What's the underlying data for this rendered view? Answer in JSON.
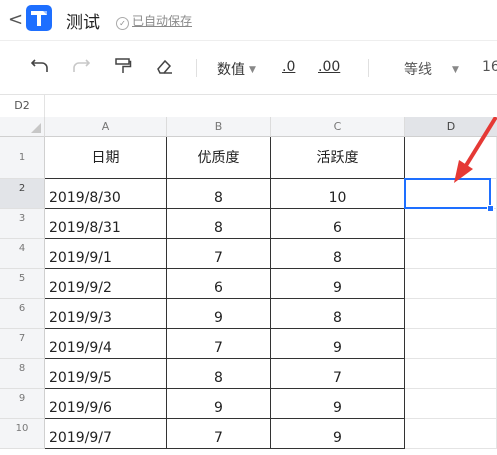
{
  "app": {
    "back_symbol": "<",
    "title": "测试",
    "save_status": "已自动保存",
    "brand_color": "#1e6fff"
  },
  "toolbar": {
    "number_format": "数值",
    "decrease_decimal": ".0",
    "increase_decimal": ".00",
    "font_name": "等线",
    "font_size": "16",
    "icons": [
      "undo-icon",
      "redo-icon",
      "format-painter-icon",
      "eraser-icon"
    ]
  },
  "formula_bar": {
    "cell_ref": "D2"
  },
  "sheet": {
    "columns": [
      "A",
      "B",
      "C",
      "D"
    ],
    "row_numbers": [
      "1",
      "2",
      "3",
      "4",
      "5",
      "6",
      "7",
      "8",
      "9",
      "10"
    ],
    "header": [
      "日期",
      "优质度",
      "活跃度"
    ],
    "rows": [
      [
        "2019/8/30",
        "8",
        "10"
      ],
      [
        "2019/8/31",
        "8",
        "6"
      ],
      [
        "2019/9/1",
        "7",
        "8"
      ],
      [
        "2019/9/2",
        "6",
        "9"
      ],
      [
        "2019/9/3",
        "9",
        "8"
      ],
      [
        "2019/9/4",
        "7",
        "9"
      ],
      [
        "2019/9/5",
        "8",
        "7"
      ],
      [
        "2019/9/6",
        "9",
        "9"
      ],
      [
        "2019/9/7",
        "7",
        "9"
      ]
    ],
    "selected_cell": "D2",
    "selection_color": "#1e6fff",
    "annotation_arrow_color": "#e53935"
  }
}
